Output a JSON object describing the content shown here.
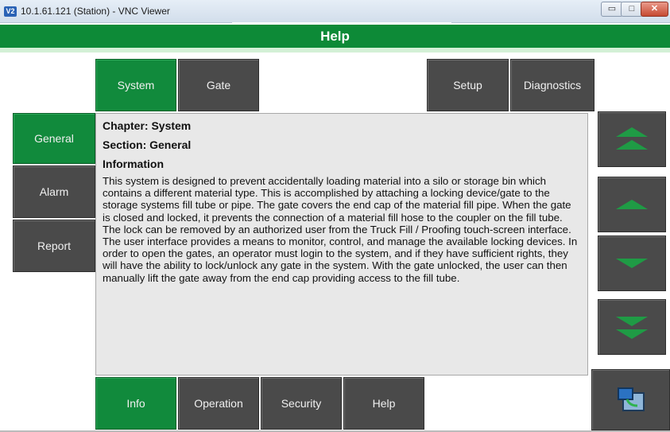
{
  "window": {
    "title": "10.1.61.121 (Station) - VNC Viewer",
    "icon_text": "V2",
    "controls": {
      "minimize": "▭",
      "maximize": "□",
      "close": "✕"
    }
  },
  "header": {
    "title": "Help"
  },
  "top_tabs": {
    "system": "System",
    "gate": "Gate",
    "setup": "Setup",
    "diagnostics": "Diagnostics"
  },
  "side_tabs": {
    "general": "General",
    "alarm": "Alarm",
    "report": "Report"
  },
  "content": {
    "chapter": "Chapter: System",
    "section": "Section: General",
    "info_heading": "Information",
    "text": "This system is designed to prevent accidentally loading material into a silo or storage bin which contains a different material type. This is accomplished by attaching a locking device/gate to the storage systems fill tube or pipe.  The gate covers the end cap of the material fill pipe.  When the gate is closed and locked, it prevents the connection of a material fill hose to the coupler on the fill tube.  The lock can be removed by an authorized user from the Truck Fill / Proofing touch-screen interface.  The user interface provides a means to monitor, control, and manage the available locking devices.  In order to open the gates, an operator must login to the system, and if they have sufficient rights, they will have the ability to lock/unlock any gate in the system.  With the gate unlocked, the user can then manually lift the gate away from the end cap providing access to the fill tube."
  },
  "bottom_tabs": {
    "info": "Info",
    "operation": "Operation",
    "security": "Security",
    "help": "Help"
  },
  "colors": {
    "green": "#118a3c",
    "dark_button": "#4a4a4a",
    "header_green": "#0d8a37",
    "arrow": "#1f9b45"
  },
  "icons": [
    "app-icon",
    "scroll-top-icon",
    "scroll-up-icon",
    "scroll-down-icon",
    "scroll-bottom-icon",
    "screen-switch-icon"
  ]
}
